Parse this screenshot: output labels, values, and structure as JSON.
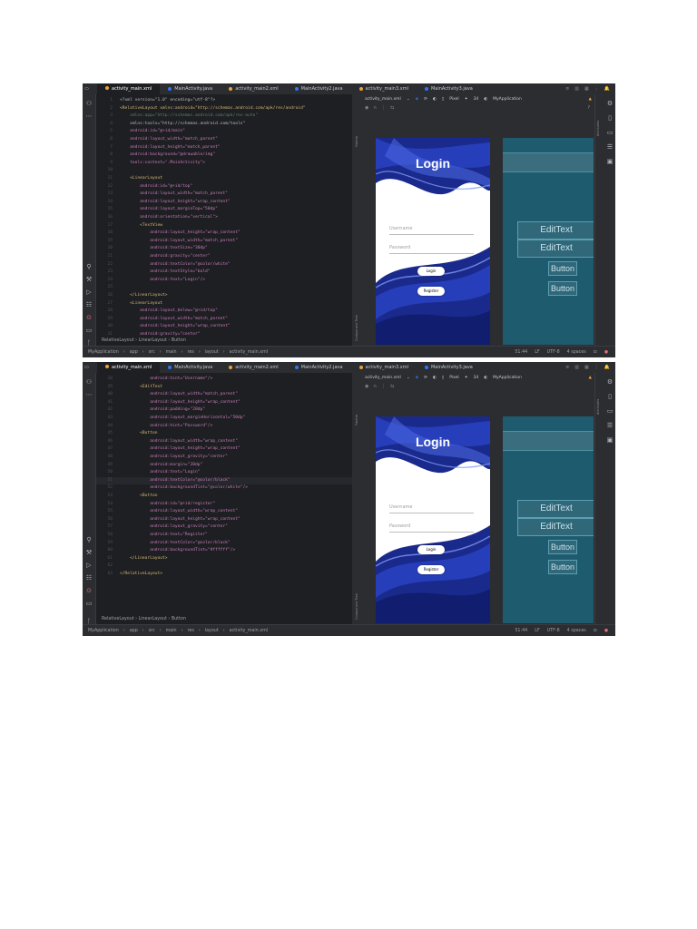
{
  "tabs": [
    {
      "label": "activity_main.xml",
      "kind": "xml"
    },
    {
      "label": "MainActivity.java",
      "kind": "java"
    },
    {
      "label": "activity_main2.xml",
      "kind": "xml"
    },
    {
      "label": "MainActivity2.java",
      "kind": "java"
    },
    {
      "label": "activity_main3.xml",
      "kind": "xml"
    },
    {
      "label": "MainActivity3.java",
      "kind": "java"
    }
  ],
  "design_toolbar": {
    "file": "activity_main.xml",
    "device": "Pixel",
    "api": "34",
    "app": "MyApplication"
  },
  "side_labels": {
    "palette": "Palette",
    "component_tree": "Component Tree",
    "attributes": "Attributes"
  },
  "phone": {
    "title": "Login",
    "username_hint": "Username",
    "password_hint": "Password",
    "login_button": "Login",
    "register_button": "Register"
  },
  "blueprint": {
    "edittext1": "EditText",
    "edittext2": "EditText",
    "button1": "Button",
    "button2": "Button"
  },
  "breadcrumb": [
    "RelativeLayout",
    "LinearLayout",
    "Button"
  ],
  "statusbar": {
    "path": [
      "MyApplication",
      "app",
      "src",
      "main",
      "res",
      "layout",
      "activity_main.xml"
    ],
    "position": "51:44",
    "line_sep": "LF",
    "encoding": "UTF-8",
    "indent": "4 spaces"
  },
  "code1": [
    {
      "n": "1",
      "text": "<?xml version=\"1.0\" encoding=\"utf-8\"?>",
      "cls": "t-plain"
    },
    {
      "n": "2",
      "text": "<RelativeLayout xmlns:android=\"http://schemas.android.com/apk/res/android\"",
      "cls": "t-tag"
    },
    {
      "n": "3",
      "text": "    xmlns:app=\"http://schemas.android.com/apk/res-auto\"",
      "cls": "t-ns"
    },
    {
      "n": "4",
      "text": "    xmlns:tools=\"http://schemas.android.com/tools\"",
      "cls": "t-plain"
    },
    {
      "n": "5",
      "text": "    android:id=\"@+id/main\"",
      "cls": "t-attr"
    },
    {
      "n": "6",
      "text": "    android:layout_width=\"match_parent\"",
      "cls": "t-attr"
    },
    {
      "n": "7",
      "text": "    android:layout_height=\"match_parent\"",
      "cls": "t-attr"
    },
    {
      "n": "8",
      "text": "    android:background=\"@drawable/img\"",
      "cls": "t-attr"
    },
    {
      "n": "9",
      "text": "    tools:context=\".MainActivity\">",
      "cls": "t-attr"
    },
    {
      "n": "10",
      "text": "",
      "cls": "t-plain"
    },
    {
      "n": "11",
      "text": "    <LinearLayout",
      "cls": "t-tag"
    },
    {
      "n": "12",
      "text": "        android:id=\"@+id/top\"",
      "cls": "t-attr"
    },
    {
      "n": "13",
      "text": "        android:layout_width=\"match_parent\"",
      "cls": "t-attr"
    },
    {
      "n": "14",
      "text": "        android:layout_height=\"wrap_content\"",
      "cls": "t-attr"
    },
    {
      "n": "15",
      "text": "        android:layout_marginTop=\"50dp\"",
      "cls": "t-attr"
    },
    {
      "n": "16",
      "text": "        android:orientation=\"vertical\">",
      "cls": "t-attr"
    },
    {
      "n": "17",
      "text": "        <TextView",
      "cls": "t-tag"
    },
    {
      "n": "18",
      "text": "            android:layout_height=\"wrap_content\"",
      "cls": "t-attr"
    },
    {
      "n": "19",
      "text": "            android:layout_width=\"match_parent\"",
      "cls": "t-attr"
    },
    {
      "n": "20",
      "text": "            android:textSize=\"30dp\"",
      "cls": "t-attr"
    },
    {
      "n": "21",
      "text": "            android:gravity=\"center\"",
      "cls": "t-attr"
    },
    {
      "n": "22",
      "text": "            android:textColor=\"@color/white\"",
      "cls": "t-attr"
    },
    {
      "n": "23",
      "text": "            android:textStyle=\"bold\"",
      "cls": "t-attr"
    },
    {
      "n": "24",
      "text": "            android:text=\"Login\"/>",
      "cls": "t-attr"
    },
    {
      "n": "25",
      "text": "",
      "cls": "t-plain"
    },
    {
      "n": "26",
      "text": "    </LinearLayout>",
      "cls": "t-tag"
    },
    {
      "n": "27",
      "text": "    <LinearLayout",
      "cls": "t-tag"
    },
    {
      "n": "28",
      "text": "        android:layout_below=\"@+id/top\"",
      "cls": "t-attr"
    },
    {
      "n": "29",
      "text": "        android:layout_width=\"match_parent\"",
      "cls": "t-attr"
    },
    {
      "n": "30",
      "text": "        android:layout_height=\"wrap_content\"",
      "cls": "t-attr"
    },
    {
      "n": "31",
      "text": "        android:gravity=\"center\"",
      "cls": "t-attr"
    }
  ],
  "code2": [
    {
      "n": "38",
      "text": "            android:hint=\"Username\"/>",
      "cls": "t-attr"
    },
    {
      "n": "39",
      "text": "        <EditText",
      "cls": "t-tag"
    },
    {
      "n": "40",
      "text": "            android:layout_width=\"match_parent\"",
      "cls": "t-attr"
    },
    {
      "n": "41",
      "text": "            android:layout_height=\"wrap_content\"",
      "cls": "t-attr"
    },
    {
      "n": "42",
      "text": "            android:padding=\"20dp\"",
      "cls": "t-attr"
    },
    {
      "n": "43",
      "text": "            android:layout_marginHorizontal=\"50dp\"",
      "cls": "t-attr"
    },
    {
      "n": "44",
      "text": "            android:hint=\"Password\"/>",
      "cls": "t-attr"
    },
    {
      "n": "45",
      "text": "        <Button",
      "cls": "t-tag"
    },
    {
      "n": "46",
      "text": "            android:layout_width=\"wrap_content\"",
      "cls": "t-attr"
    },
    {
      "n": "47",
      "text": "            android:layout_height=\"wrap_content\"",
      "cls": "t-attr"
    },
    {
      "n": "48",
      "text": "            android:layout_gravity=\"center\"",
      "cls": "t-attr"
    },
    {
      "n": "49",
      "text": "            android:margin=\"20dp\"",
      "cls": "t-attr"
    },
    {
      "n": "50",
      "text": "            android:text=\"Login\"",
      "cls": "t-attr"
    },
    {
      "n": "51",
      "text": "            android:textColor=\"@color/black\"",
      "cls": "t-attr"
    },
    {
      "n": "52",
      "text": "            android:backgroundTint=\"@color/white\"/>",
      "cls": "t-attr"
    },
    {
      "n": "53",
      "text": "        <Button",
      "cls": "t-tag"
    },
    {
      "n": "54",
      "text": "            android:id=\"@+id/register\"",
      "cls": "t-attr"
    },
    {
      "n": "55",
      "text": "            android:layout_width=\"wrap_content\"",
      "cls": "t-attr"
    },
    {
      "n": "56",
      "text": "            android:layout_height=\"wrap_content\"",
      "cls": "t-attr"
    },
    {
      "n": "57",
      "text": "            android:layout_gravity=\"center\"",
      "cls": "t-attr"
    },
    {
      "n": "58",
      "text": "            android:text=\"Register\"",
      "cls": "t-attr"
    },
    {
      "n": "59",
      "text": "            android:textColor=\"@color/black\"",
      "cls": "t-attr"
    },
    {
      "n": "60",
      "text": "            android:backgroundTint=\"#ffffff\"/>",
      "cls": "t-attr"
    },
    {
      "n": "61",
      "text": "    </LinearLayout>",
      "cls": "t-tag"
    },
    {
      "n": "62",
      "text": "",
      "cls": "t-plain"
    },
    {
      "n": "63",
      "text": "</RelativeLayout>",
      "cls": "t-tag"
    }
  ],
  "colors": {
    "ide_bg": "#1e1f22",
    "panel_bg": "#2b2d30",
    "accent": "#3574f0",
    "wave_blue": "#1b2f9e",
    "blueprint": "#1f5b6e"
  }
}
